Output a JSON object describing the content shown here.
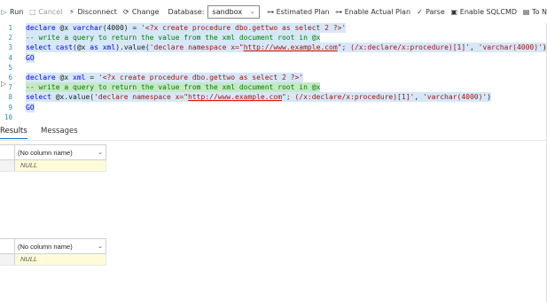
{
  "toolbar": {
    "run": "Run",
    "cancel": "Cancel",
    "disconnect": "Disconnect",
    "change": "Change",
    "database_label": "Database:",
    "database_value": "sandbox",
    "estimated_plan": "Estimated Plan",
    "enable_actual_plan": "Enable Actual Plan",
    "parse": "Parse",
    "enable_sqlcmd": "Enable SQLCMD",
    "to_notebook": "To N"
  },
  "editor": {
    "lines": [
      {
        "n": "1",
        "segs": [
          [
            "kw",
            "declare"
          ],
          [
            "plain",
            " @x "
          ],
          [
            "kw",
            "varchar"
          ],
          [
            "plain",
            "(4000) = "
          ],
          [
            "str",
            "'<?x create procedure dbo.gettwo as select 2 ?>'"
          ]
        ]
      },
      {
        "n": "2",
        "segs": [
          [
            "cmt",
            "-- write a query to return the value from the xml document root in @x"
          ]
        ]
      },
      {
        "n": "3",
        "segs": [
          [
            "kw",
            "select"
          ],
          [
            "plain",
            " "
          ],
          [
            "kw",
            "cast"
          ],
          [
            "plain",
            "(@x "
          ],
          [
            "kw",
            "as"
          ],
          [
            "plain",
            " "
          ],
          [
            "kw",
            "xml"
          ],
          [
            "plain",
            ").value("
          ],
          [
            "str",
            "'declare namespace x=\""
          ],
          [
            "url",
            "http://www.example.com"
          ],
          [
            "str",
            "\"; (/x:declare/x:procedure)[1]'"
          ],
          [
            "plain",
            ", "
          ],
          [
            "str",
            "'varchar(4000)'"
          ],
          [
            "plain",
            ")"
          ]
        ]
      },
      {
        "n": "4",
        "segs": [
          [
            "kw",
            "GO"
          ]
        ]
      },
      {
        "n": "5",
        "segs": []
      },
      {
        "n": "6",
        "segs": [
          [
            "kw",
            "declare"
          ],
          [
            "plain",
            " @x "
          ],
          [
            "kw",
            "xml"
          ],
          [
            "plain",
            " = "
          ],
          [
            "str",
            "'<?x create procedure dbo.gettwo as select 2 ?>'"
          ]
        ]
      },
      {
        "n": "7",
        "segs": [
          [
            "cmt",
            "-- write a query to return the value from the xml document root in @x"
          ]
        ]
      },
      {
        "n": "8",
        "segs": [
          [
            "kw",
            "select"
          ],
          [
            "plain",
            " @x.value("
          ],
          [
            "str",
            "'declare namespace x=\""
          ],
          [
            "url",
            "http://www.example.com"
          ],
          [
            "str",
            "\"; (/x:declare/x:procedure)[1]'"
          ],
          [
            "plain",
            ", "
          ],
          [
            "str",
            "'varchar(4000)'"
          ],
          [
            "plain",
            ")"
          ]
        ]
      },
      {
        "n": "9",
        "segs": [
          [
            "kw",
            "GO"
          ]
        ]
      },
      {
        "n": "10",
        "segs": []
      }
    ]
  },
  "results_tabs": {
    "results": "Results",
    "messages": "Messages"
  },
  "result_grids": [
    {
      "header": "(No column name)",
      "cell": "NULL"
    },
    {
      "header": "(No column name)",
      "cell": "NULL"
    }
  ],
  "colors": {
    "keyword": "#0000ff",
    "string": "#a31515",
    "comment": "#008000",
    "selection": "#d6e8f8",
    "null_cell": "#fffbd9",
    "accent": "#0078d4"
  }
}
